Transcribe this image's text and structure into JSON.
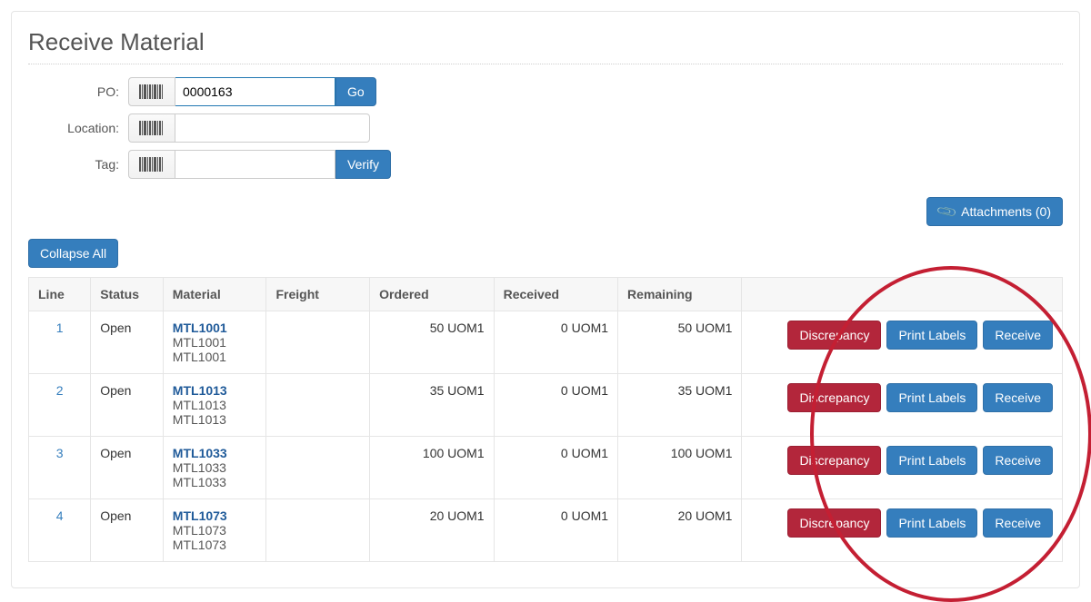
{
  "page": {
    "title": "Receive Material"
  },
  "form": {
    "po_label": "PO:",
    "po_value": "0000163",
    "go_label": "Go",
    "location_label": "Location:",
    "location_value": "",
    "tag_label": "Tag:",
    "tag_value": "",
    "verify_label": "Verify"
  },
  "attachments": {
    "count": 0,
    "label": "Attachments (0)"
  },
  "collapse_all": "Collapse All",
  "columns": {
    "line": "Line",
    "status": "Status",
    "material": "Material",
    "freight": "Freight",
    "ordered": "Ordered",
    "received": "Received",
    "remaining": "Remaining"
  },
  "row_action_labels": {
    "discrepancy": "Discrepancy",
    "print_labels": "Print Labels",
    "receive": "Receive"
  },
  "rows": [
    {
      "line": "1",
      "status": "Open",
      "mat_code": "MTL1001",
      "mat_l2": "MTL1001",
      "mat_l3": "MTL1001",
      "freight": "",
      "ordered": "50 UOM1",
      "received": "0 UOM1",
      "remaining": "50 UOM1"
    },
    {
      "line": "2",
      "status": "Open",
      "mat_code": "MTL1013",
      "mat_l2": "MTL1013",
      "mat_l3": "MTL1013",
      "freight": "",
      "ordered": "35 UOM1",
      "received": "0 UOM1",
      "remaining": "35 UOM1"
    },
    {
      "line": "3",
      "status": "Open",
      "mat_code": "MTL1033",
      "mat_l2": "MTL1033",
      "mat_l3": "MTL1033",
      "freight": "",
      "ordered": "100 UOM1",
      "received": "0 UOM1",
      "remaining": "100 UOM1"
    },
    {
      "line": "4",
      "status": "Open",
      "mat_code": "MTL1073",
      "mat_l2": "MTL1073",
      "mat_l3": "MTL1073",
      "freight": "",
      "ordered": "20 UOM1",
      "received": "0 UOM1",
      "remaining": "20 UOM1"
    }
  ]
}
